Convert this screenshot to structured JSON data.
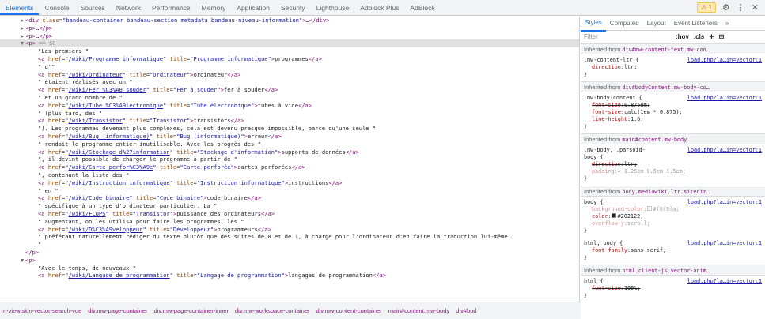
{
  "toolbar": {
    "tabs": [
      "Elements",
      "Console",
      "Sources",
      "Network",
      "Performance",
      "Memory",
      "Application",
      "Security",
      "Lighthouse",
      "Adblock Plus",
      "AdBlock"
    ],
    "warning_icon": "warning-icon",
    "warning_count": "1",
    "settings_icon": "gear-icon",
    "more_icon": "kebab-menu-icon",
    "close_icon": "close-icon"
  },
  "elements": {
    "lines": [
      {
        "indent": 3,
        "tri": "▶",
        "html": "<span class='tag'>&lt;div</span> <span class='attr'>class</span>=<span class='val'>\"bandeau-container bandeau-section metadata bandeau-niveau-information\"</span><span class='tag'>&gt;</span>…<span class='tag'>&lt;/div&gt;</span>"
      },
      {
        "indent": 3,
        "tri": "▶",
        "html": "<span class='tag'>&lt;p&gt;</span>…<span class='tag'>&lt;/p&gt;</span>"
      },
      {
        "indent": 3,
        "tri": "▶",
        "html": "<span class='tag'>&lt;p&gt;</span>…<span class='tag'>&lt;/p&gt;</span>"
      },
      {
        "indent": 3,
        "tri": "▼",
        "selected": true,
        "html": "<span class='tag'>&lt;p&gt;</span> <span class='dim'>== $0</span>"
      },
      {
        "indent": 5,
        "html": "<span class='txt'>\"Les premiers \"</span>"
      },
      {
        "indent": 5,
        "html": "<span class='tag'>&lt;a</span> <span class='attr'>href</span>=<span class='val'>\"</span><span class='link'>/wiki/Programme_informatique</span><span class='val'>\"</span> <span class='attr'>title</span>=<span class='val'>\"Programme informatique\"</span><span class='tag'>&gt;</span>programmes<span class='tag'>&lt;/a&gt;</span>"
      },
      {
        "indent": 5,
        "html": "<span class='txt'>\" d'\"</span>"
      },
      {
        "indent": 5,
        "html": "<span class='tag'>&lt;a</span> <span class='attr'>href</span>=<span class='val'>\"</span><span class='link'>/wiki/Ordinateur</span><span class='val'>\"</span> <span class='attr'>title</span>=<span class='val'>\"Ordinateur\"</span><span class='tag'>&gt;</span>ordinateur<span class='tag'>&lt;/a&gt;</span>"
      },
      {
        "indent": 5,
        "html": "<span class='txt'>\" étaient réalisés avec un \"</span>"
      },
      {
        "indent": 5,
        "html": "<span class='tag'>&lt;a</span> <span class='attr'>href</span>=<span class='val'>\"</span><span class='link'>/wiki/Fer_%C3%A0_souder</span><span class='val'>\"</span> <span class='attr'>title</span>=<span class='val'>\"Fer à souder\"</span><span class='tag'>&gt;</span>fer à souder<span class='tag'>&lt;/a&gt;</span>"
      },
      {
        "indent": 5,
        "html": "<span class='txt'>\" et un grand nombre de \"</span>"
      },
      {
        "indent": 5,
        "html": "<span class='tag'>&lt;a</span> <span class='attr'>href</span>=<span class='val'>\"</span><span class='link'>/wiki/Tube_%C3%A9lectronique</span><span class='val'>\"</span> <span class='attr'>title</span>=<span class='val'>\"Tube électronique\"</span><span class='tag'>&gt;</span>tubes à vide<span class='tag'>&lt;/a&gt;</span>"
      },
      {
        "indent": 5,
        "html": "<span class='txt'>\" (plus tard, des \"</span>"
      },
      {
        "indent": 5,
        "html": "<span class='tag'>&lt;a</span> <span class='attr'>href</span>=<span class='val'>\"</span><span class='link'>/wiki/Transistor</span><span class='val'>\"</span> <span class='attr'>title</span>=<span class='val'>\"Transistor\"</span><span class='tag'>&gt;</span>transistors<span class='tag'>&lt;/a&gt;</span>"
      },
      {
        "indent": 5,
        "html": "<span class='txt'>\"). Les programmes devenant plus complexes, cela est devenu presque impossible, parce qu'une seule \"</span>"
      },
      {
        "indent": 5,
        "html": "<span class='tag'>&lt;a</span> <span class='attr'>href</span>=<span class='val'>\"</span><span class='link'>/wiki/Bug_(informatique)</span><span class='val'>\"</span> <span class='attr'>title</span>=<span class='val'>\"Bug (informatique)\"</span><span class='tag'>&gt;</span>erreur<span class='tag'>&lt;/a&gt;</span>"
      },
      {
        "indent": 5,
        "html": "<span class='txt'>\" rendait le programme entier inutilisable. Avec les progrès des \"</span>"
      },
      {
        "indent": 5,
        "html": "<span class='tag'>&lt;a</span> <span class='attr'>href</span>=<span class='val'>\"</span><span class='link'>/wiki/Stockage_d%27information</span><span class='val'>\"</span> <span class='attr'>title</span>=<span class='val'>\"Stockage d'information\"</span><span class='tag'>&gt;</span>supports de données<span class='tag'>&lt;/a&gt;</span>"
      },
      {
        "indent": 5,
        "html": "<span class='txt'>\", il devint possible de charger le programme à partir de \"</span>"
      },
      {
        "indent": 5,
        "html": "<span class='tag'>&lt;a</span> <span class='attr'>href</span>=<span class='val'>\"</span><span class='link'>/wiki/Carte_perfor%C3%A9e</span><span class='val'>\"</span> <span class='attr'>title</span>=<span class='val'>\"Carte perforée\"</span><span class='tag'>&gt;</span>cartes perforées<span class='tag'>&lt;/a&gt;</span>"
      },
      {
        "indent": 5,
        "html": "<span class='txt'>\", contenant la liste des \"</span>"
      },
      {
        "indent": 5,
        "html": "<span class='tag'>&lt;a</span> <span class='attr'>href</span>=<span class='val'>\"</span><span class='link'>/wiki/Instruction_informatique</span><span class='val'>\"</span> <span class='attr'>title</span>=<span class='val'>\"Instruction informatique\"</span><span class='tag'>&gt;</span>instructions<span class='tag'>&lt;/a&gt;</span>"
      },
      {
        "indent": 5,
        "html": "<span class='txt'>\" en \"</span>"
      },
      {
        "indent": 5,
        "html": "<span class='tag'>&lt;a</span> <span class='attr'>href</span>=<span class='val'>\"</span><span class='link'>/wiki/Code_binaire</span><span class='val'>\"</span> <span class='attr'>title</span>=<span class='val'>\"Code binaire\"</span><span class='tag'>&gt;</span>code binaire<span class='tag'>&lt;/a&gt;</span>"
      },
      {
        "indent": 5,
        "html": "<span class='txt'>\" spécifique à un type d'ordinateur particulier. La \"</span>"
      },
      {
        "indent": 5,
        "html": "<span class='tag'>&lt;a</span> <span class='attr'>href</span>=<span class='val'>\"</span><span class='link'>/wiki/FLOPS</span><span class='val'>\"</span> <span class='attr'>title</span>=<span class='val'>\"Transistor\"</span><span class='tag'>&gt;</span>puissance des ordinateurs<span class='tag'>&lt;/a&gt;</span>"
      },
      {
        "indent": 5,
        "html": "<span class='txt'>\" augmentant, on les utilisa pour faire les programmes, les \"</span>"
      },
      {
        "indent": 5,
        "html": "<span class='tag'>&lt;a</span> <span class='attr'>href</span>=<span class='val'>\"</span><span class='link'>/wiki/D%C3%A9veloppeur</span><span class='val'>\"</span> <span class='attr'>title</span>=<span class='val'>\"Développeur\"</span><span class='tag'>&gt;</span>programmeurs<span class='tag'>&lt;/a&gt;</span>"
      },
      {
        "indent": 5,
        "html": "<span class='txt'>\" préférant naturellement rédiger du texte plutôt que des suites de 0 et de 1, à charge pour l'ordinateur d'en faire la traduction lui-même.</span>"
      },
      {
        "indent": 5,
        "html": "<span class='txt'>\"</span>"
      },
      {
        "indent": 3,
        "html": "<span class='tag'>&lt;/p&gt;</span>"
      },
      {
        "indent": 3,
        "tri": "▼",
        "html": "<span class='tag'>&lt;p&gt;</span>"
      },
      {
        "indent": 5,
        "html": "<span class='txt'>\"Avec le temps, de nouveaux \"</span>"
      },
      {
        "indent": 5,
        "html": "<span class='tag'>&lt;a</span> <span class='attr'>href</span>=<span class='val'>\"</span><span class='link'>/wiki/Langage_de_programmation</span><span class='val'>\"</span> <span class='attr'>title</span>=<span class='val'>\"Langage de programmation\"</span><span class='tag'>&gt;</span>langages de programmation<span class='tag'>&lt;/a&gt;</span>"
      }
    ]
  },
  "breadcrumbs": [
    "n-view.skin-vector-search-vue",
    "div.mw-page-container",
    "div.mw-page-container-inner",
    "div.mw-workspace-container",
    "div.mw-content-container",
    "main#content.mw-body",
    "div#bod"
  ],
  "breadcrumb_more": "…",
  "styles": {
    "tabs": [
      "Styles",
      "Computed",
      "Layout",
      "Event Listeners",
      "»"
    ],
    "filter_placeholder": "Filter",
    "hov": ":hov",
    "cls": ".cls",
    "plus": "+",
    "toggle_icon": "toggle-sidebar-icon",
    "blocks": [
      {
        "inherited_label": "Inherited from",
        "inherited_selector": "div#mw-content-text.mw-con…",
        "rules": [
          {
            "selector": ".mw-content-ltr {",
            "source": "load.php?la…in=vector:1",
            "props": [
              {
                "name": "direction",
                "value": "ltr;",
                "struck": false
              }
            ]
          }
        ]
      },
      {
        "inherited_label": "Inherited from",
        "inherited_selector": "div#bodyContent.mw-body-co…",
        "rules": [
          {
            "selector": ".mw-body-content {",
            "source": "load.php?la…in=vector:1",
            "props": [
              {
                "name": "font-size",
                "value": "0.875em;",
                "struck": true
              },
              {
                "name": "font-size",
                "value": "calc(1em * 0.875);",
                "struck": false
              },
              {
                "name": "line-height",
                "value": "1.6;",
                "struck": false
              }
            ]
          }
        ]
      },
      {
        "inherited_label": "Inherited from",
        "inherited_selector": "main#content.mw-body",
        "rules": [
          {
            "selector": ".mw-body, .parsoid-",
            "source": "load.php?la…in=vector:1",
            "selector2": "body {",
            "props": [
              {
                "name": "direction",
                "value": "ltr;",
                "struck": true
              },
              {
                "name": "padding",
                "value": "▸ 1.25em 0.5em 1.5em;",
                "struck": false,
                "faded": true
              }
            ]
          }
        ]
      },
      {
        "inherited_label": "Inherited from",
        "inherited_selector": "body.mediawiki.ltr.sitedir…",
        "rules": [
          {
            "selector": "body {",
            "source": "load.php?la…in=vector:1",
            "props": [
              {
                "name": "background-color",
                "value": "#f8f9fa;",
                "struck": false,
                "faded": true,
                "swatch": "#f8f9fa"
              },
              {
                "name": "color",
                "value": "#202122;",
                "struck": false,
                "swatch": "#202122"
              },
              {
                "name": "overflow-y",
                "value": "scroll;",
                "struck": false,
                "faded": true
              }
            ]
          },
          {
            "selector": "html, body {",
            "source": "load.php?la…in=vector:1",
            "props": [
              {
                "name": "font-family",
                "value": "sans-serif;",
                "struck": false
              }
            ]
          }
        ]
      },
      {
        "inherited_label": "Inherited from",
        "inherited_selector": "html.client-js.vector-anim…",
        "rules": [
          {
            "selector": "html {",
            "source": "load.php?la…in=vector:1",
            "props": [
              {
                "name": "font-size",
                "value": "100%;",
                "struck": true
              }
            ]
          }
        ]
      }
    ]
  },
  "colors": {
    "accent": "#1a73e8",
    "tag": "#881280",
    "attr": "#994500",
    "value": "#1a1aa6",
    "prop_name": "#c80000",
    "selection": "#e0e0e0"
  }
}
